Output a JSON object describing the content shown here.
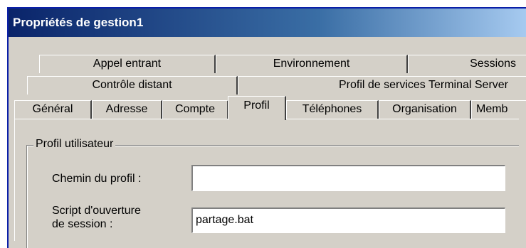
{
  "window": {
    "title": "Propriétés de gestion1"
  },
  "tabs": {
    "row1": [
      "Appel entrant",
      "Environnement",
      "Sessions"
    ],
    "row2": [
      "Contrôle distant",
      "Profil de services Terminal Server"
    ],
    "row3": [
      "Général",
      "Adresse",
      "Compte",
      "Profil",
      "Téléphones",
      "Organisation",
      "Memb"
    ],
    "selected": "Profil"
  },
  "profile_group": {
    "legend": "Profil utilisateur",
    "profile_path_label": "Chemin du profil :",
    "profile_path_value": "",
    "logon_script_label_line1": "Script d'ouverture",
    "logon_script_label_line2": "de session :",
    "logon_script_value": "partage.bat"
  }
}
